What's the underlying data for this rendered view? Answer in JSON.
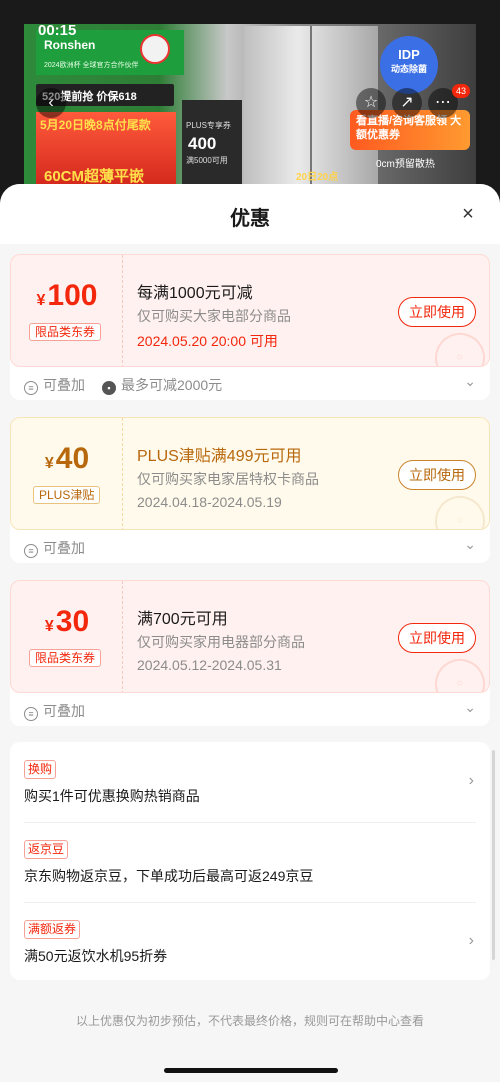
{
  "background": {
    "time": "00:15",
    "brand": "Ronshen",
    "brand_sub": "2024欧洲杯 全球官方合作伙伴",
    "banner": "520提前抢 价保618",
    "red_text": "5月20日晚8点付尾款",
    "big_text": "60CM超薄平嵌",
    "plus_label": "PLUS专享券",
    "plus_value": "400",
    "plus_sub": "满5000可用",
    "idp_title": "IDP",
    "idp_sub": "动态除菌",
    "coupon_banner": "看直播/咨询客服领 大额优惠券",
    "zero_text": "0cm预留散热",
    "date_text": "20日20点",
    "badge": "43",
    "icons": {
      "back": "chevron-left-icon",
      "favorite": "star-icon",
      "share": "share-icon",
      "more": "more-icon"
    }
  },
  "sheet": {
    "title": "优惠",
    "close_icon": "close-icon"
  },
  "coupons": [
    {
      "currency": "¥",
      "amount": "100",
      "tag": "限品类东券",
      "title": "每满1000元可减",
      "scope": "仅可购买大家电部分商品",
      "time": "2024.05.20 20:00 可用",
      "button": "立即使用",
      "foot": [
        "可叠加",
        "最多可减2000元"
      ]
    },
    {
      "currency": "¥",
      "amount": "40",
      "tag": "PLUS津贴",
      "title": "PLUS津贴满499元可用",
      "scope": "仅可购买家电家居特权卡商品",
      "time": "2024.04.18-2024.05.19",
      "button": "立即使用",
      "foot": [
        "可叠加"
      ]
    },
    {
      "currency": "¥",
      "amount": "30",
      "tag": "限品类东券",
      "title": "满700元可用",
      "scope": "仅可购买家用电器部分商品",
      "time": "2024.05.12-2024.05.31",
      "button": "立即使用",
      "foot": [
        "可叠加"
      ]
    }
  ],
  "promotions": [
    {
      "tag": "换购",
      "text": "购买1件可优惠换购热销商品",
      "has_arrow": true
    },
    {
      "tag": "返京豆",
      "text": "京东购物返京豆，下单成功后最高可返249京豆",
      "has_arrow": false
    },
    {
      "tag": "满额返券",
      "text": "满50元返饮水机95折券",
      "has_arrow": true
    }
  ],
  "disclaimer": "以上优惠仅为初步预估，不代表最终价格，规则可在帮助中心查看",
  "colors": {
    "accent": "#f2270c",
    "plus_gold": "#b8680c",
    "sheet_bg": "#f6f6f6"
  }
}
